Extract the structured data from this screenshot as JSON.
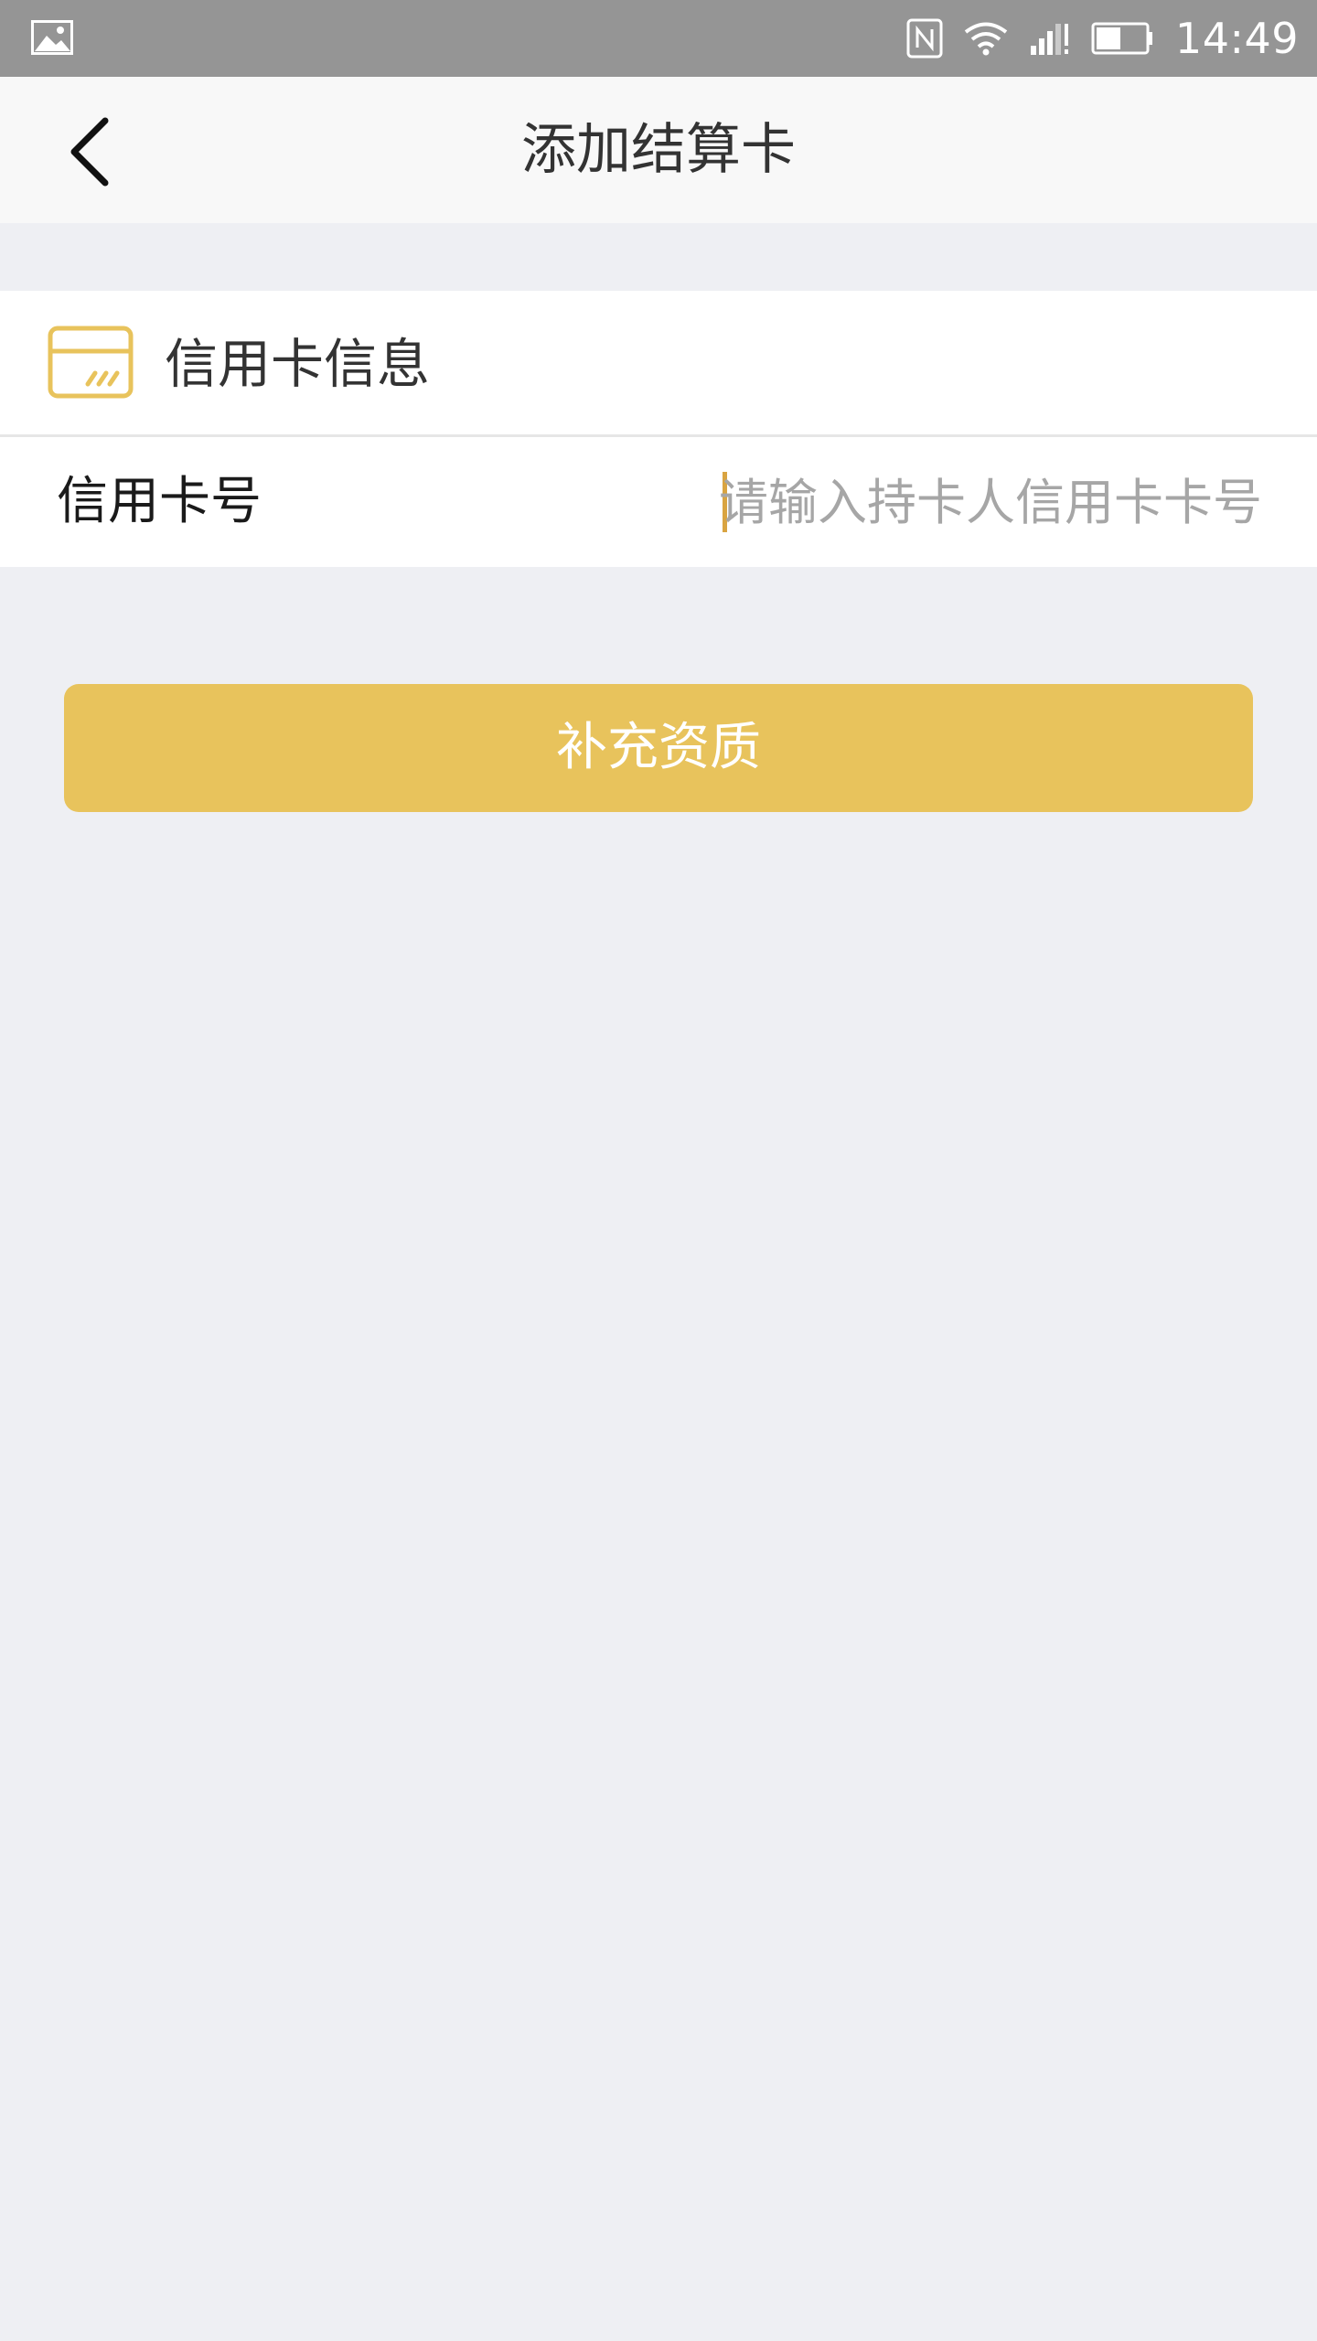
{
  "status_bar": {
    "time": "14:49",
    "icons": [
      "gallery-icon",
      "nfc-icon",
      "wifi-icon",
      "signal-icon",
      "battery-icon"
    ]
  },
  "nav": {
    "back_icon": "chevron-left-icon",
    "title": "添加结算卡"
  },
  "section": {
    "icon": "credit-card-icon",
    "title": "信用卡信息"
  },
  "form": {
    "card_number_label": "信用卡号",
    "card_number_value": "",
    "card_number_placeholder": "请输入持卡人信用卡卡号"
  },
  "actions": {
    "submit_label": "补充资质"
  },
  "colors": {
    "accent": "#e8c35c",
    "status_bar": "#959595",
    "page_background": "#eeeff3",
    "cursor": "#d9a441"
  }
}
